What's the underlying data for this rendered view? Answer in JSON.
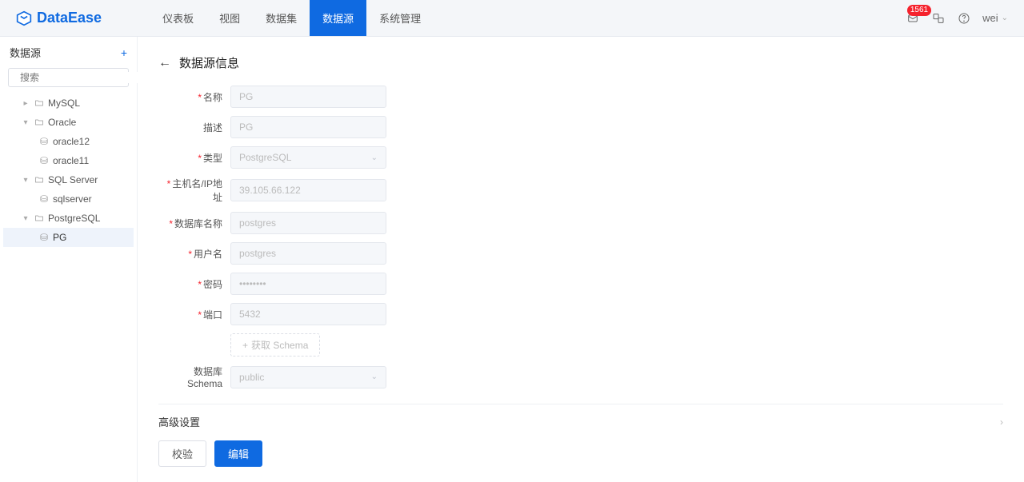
{
  "header": {
    "logo_text": "DataEase",
    "nav": [
      "仪表板",
      "视图",
      "数据集",
      "数据源",
      "系统管理"
    ],
    "nav_active_index": 3,
    "badge_count": "1561",
    "user": "wei"
  },
  "sidebar": {
    "title": "数据源",
    "search_placeholder": "搜索",
    "tree": [
      {
        "type": "folder",
        "label": "MySQL",
        "level": 1
      },
      {
        "type": "folder",
        "label": "Oracle",
        "level": 1
      },
      {
        "type": "ds",
        "label": "oracle12",
        "level": 2
      },
      {
        "type": "ds",
        "label": "oracle11",
        "level": 2
      },
      {
        "type": "folder",
        "label": "SQL Server",
        "level": 1
      },
      {
        "type": "ds",
        "label": "sqlserver",
        "level": 2
      },
      {
        "type": "folder",
        "label": "PostgreSQL",
        "level": 1
      },
      {
        "type": "ds",
        "label": "PG",
        "level": 2,
        "selected": true
      }
    ]
  },
  "main": {
    "title": "数据源信息",
    "fields": {
      "name_label": "名称",
      "name_value": "PG",
      "desc_label": "描述",
      "desc_value": "PG",
      "type_label": "类型",
      "type_value": "PostgreSQL",
      "host_label": "主机名/IP地址",
      "host_value": "39.105.66.122",
      "db_label": "数据库名称",
      "db_value": "postgres",
      "user_label": "用户名",
      "user_value": "postgres",
      "pwd_label": "密码",
      "pwd_value": "••••••••",
      "port_label": "端口",
      "port_value": "5432",
      "fetch_schema": "获取 Schema",
      "schema_label": "数据库 Schema",
      "schema_value": "public"
    },
    "advanced": "高级设置",
    "actions": {
      "verify": "校验",
      "edit": "编辑"
    }
  }
}
